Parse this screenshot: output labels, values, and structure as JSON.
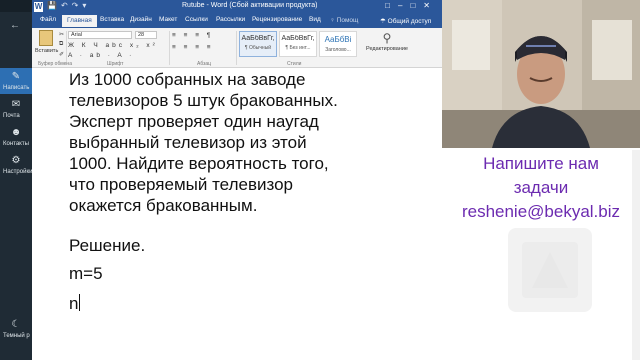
{
  "sidebar": {
    "back_glyph": "←",
    "items": [
      {
        "label": "Написать",
        "icon": "pencil-icon"
      },
      {
        "label": "Почта",
        "icon": "mail-icon"
      },
      {
        "label": "Контакты",
        "icon": "contacts-icon"
      },
      {
        "label": "Настройки",
        "icon": "gear-icon"
      }
    ],
    "theme_label": "Темный р",
    "accent": "#2d6fb3"
  },
  "word": {
    "title": "Rutube - Word (Сбой активации продукта)",
    "tabs": [
      "Файл",
      "Главная",
      "Вставка",
      "Дизайн",
      "Макет",
      "Ссылки",
      "Рассылки",
      "Рецензирование",
      "Вид"
    ],
    "active_tab": "Главная",
    "tell_me": "♀ Помощ",
    "share": "☂ Общий доступ",
    "ribbon": {
      "paste_label": "Вставить",
      "font_name": "Arial",
      "font_size": "28",
      "format_buttons": "Ж К Ч abc x₂ x²",
      "format_buttons2": "A · ab · A ·",
      "para_buttons": "≡ ≡ ≡ ¶",
      "para_buttons2": "≡ ≡ ≡ ≡",
      "styles": [
        {
          "preview": "АаБбВвГг,",
          "name": "¶ Обычный"
        },
        {
          "preview": "АаБбВвГг,",
          "name": "¶ Без инт..."
        },
        {
          "preview": "АаБбВі",
          "name": "Заголово..."
        }
      ],
      "editing_label": "Редактирование",
      "groups": [
        "Буфер обмена",
        "Шрифт",
        "Абзац",
        "Стили"
      ]
    },
    "brand_color": "#2b579a"
  },
  "document": {
    "paragraphs": [
      "Из 1000 собранных на заводе",
      "телевизоров 5 штук бракованных.",
      "Эксперт проверяет один наугад",
      "выбранный телевизор из этой",
      "1000. Найдите вероятность того,",
      "что проверяемый телевизор",
      "окажется бракованным."
    ],
    "solution_label": "Решение.",
    "m_line": "m=5",
    "n_line": "n"
  },
  "promo": {
    "line1": "Напишите нам",
    "line2": "задачи",
    "email": "reshenie@bekyal.biz",
    "color": "#6c2bb0"
  }
}
